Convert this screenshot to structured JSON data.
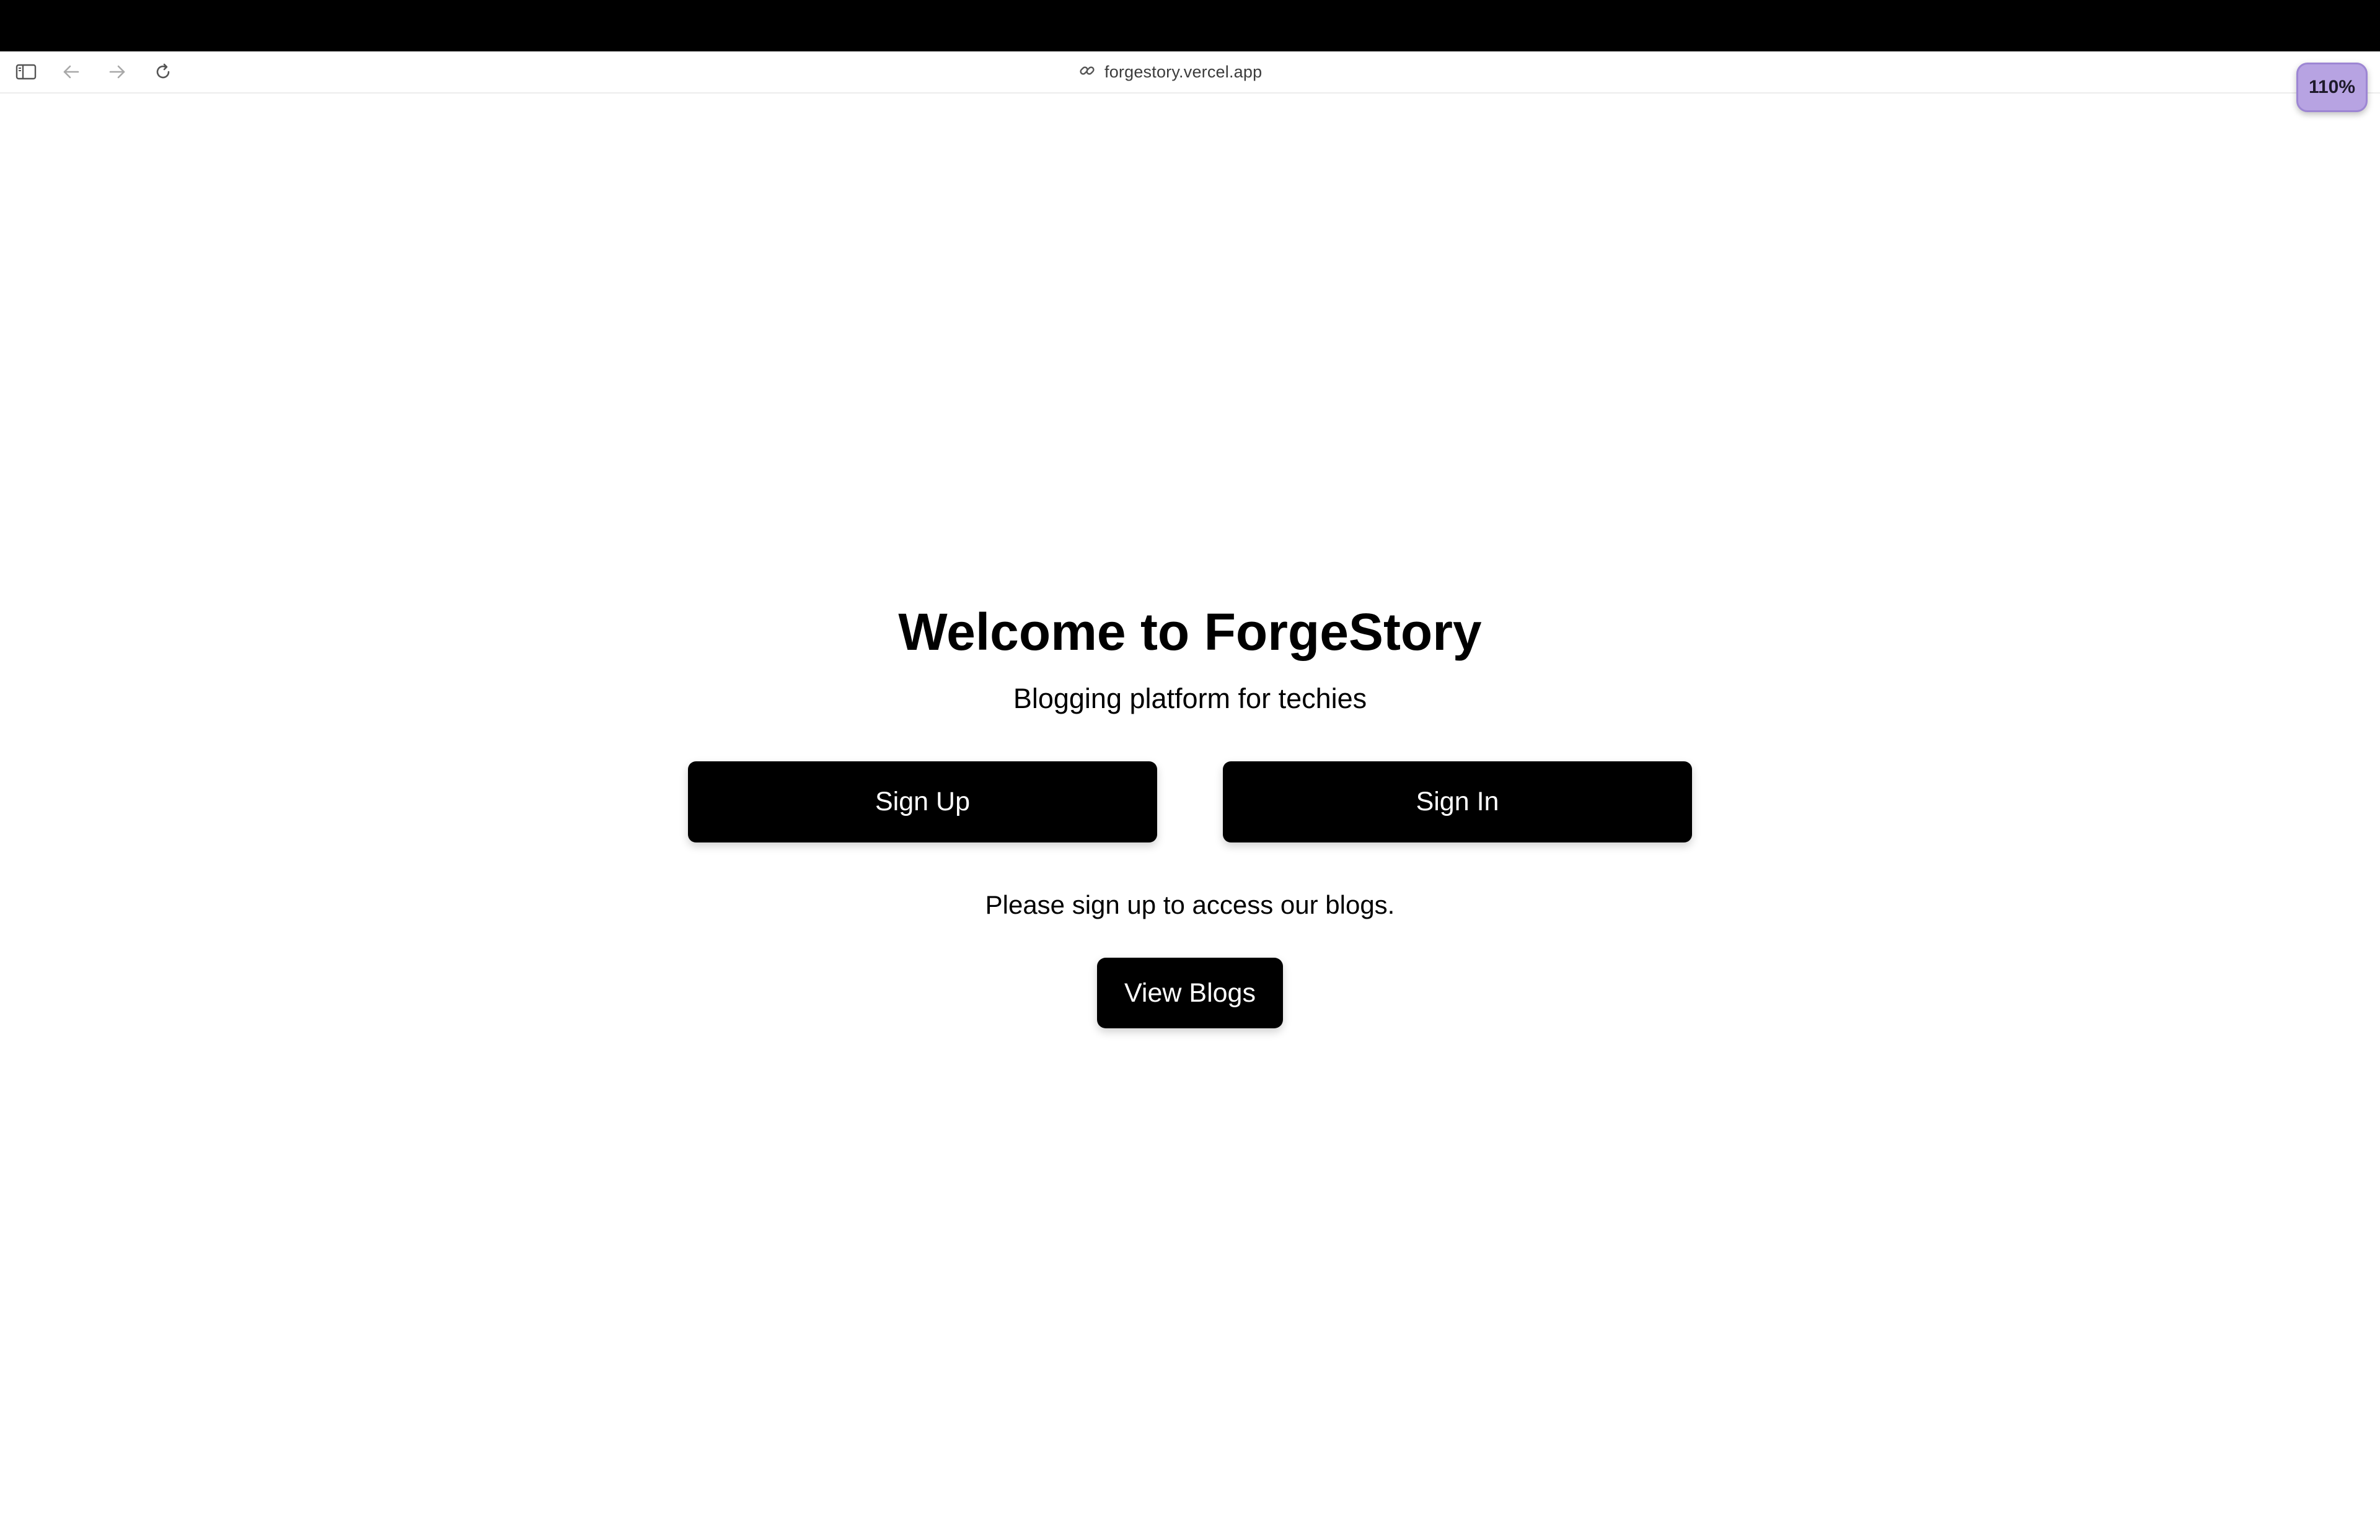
{
  "browser": {
    "url": "forgestory.vercel.app",
    "zoom_level": "110%"
  },
  "hero": {
    "title": "Welcome to ForgeStory",
    "subtitle": "Blogging platform for techies"
  },
  "actions": {
    "sign_up_label": "Sign Up",
    "sign_in_label": "Sign In"
  },
  "notice": {
    "text": "Please sign up to access our blogs."
  },
  "blogs": {
    "view_label": "View Blogs"
  },
  "icons": {
    "sidebar": "sidebar-toggle-icon",
    "back": "back-arrow-icon",
    "forward": "forward-arrow-icon",
    "reload": "reload-icon",
    "link": "link-icon"
  },
  "colors": {
    "button_bg": "#000000",
    "zoom_badge": "#b7a3e2"
  }
}
